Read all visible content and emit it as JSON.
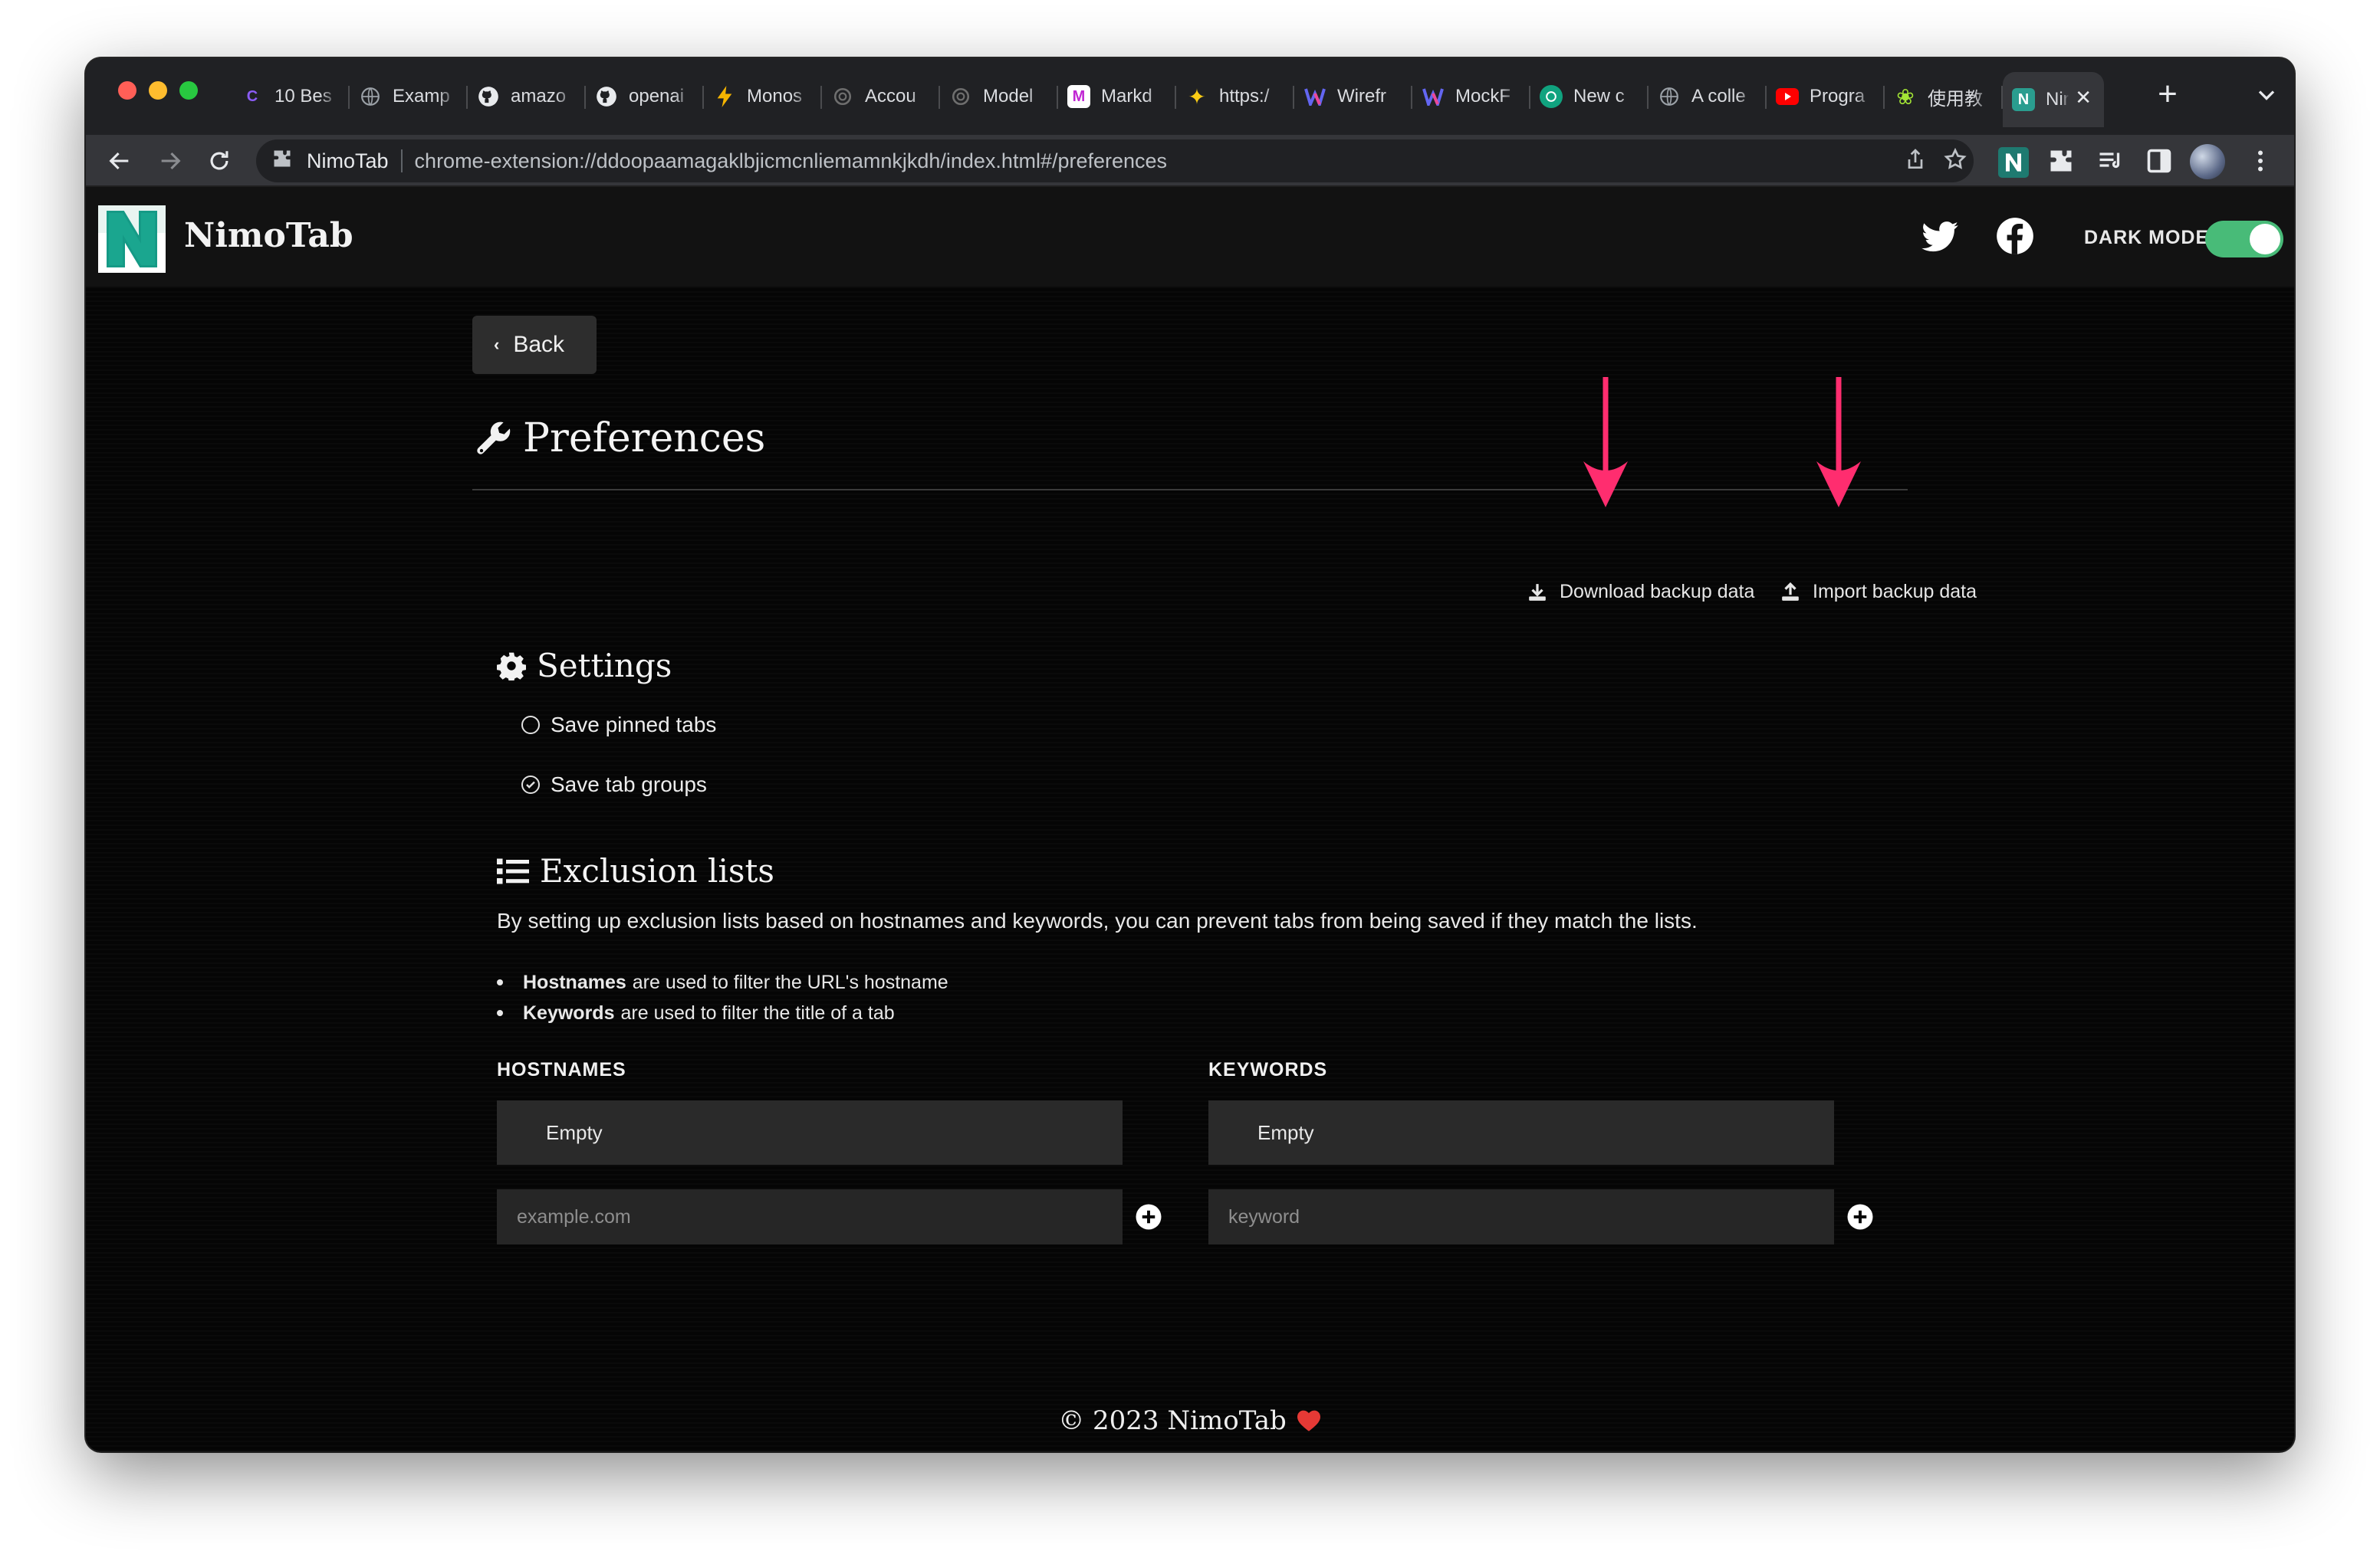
{
  "browser": {
    "tabs": [
      {
        "label": "10 Bes",
        "icon": "c-logo-icon",
        "color": "#7c3aed"
      },
      {
        "label": "Examp",
        "icon": "globe-icon",
        "color": "#9aa0a6"
      },
      {
        "label": "amazo",
        "icon": "github-icon",
        "color": "#e8eaed"
      },
      {
        "label": "openai",
        "icon": "github-icon",
        "color": "#e8eaed"
      },
      {
        "label": "Monos",
        "icon": "bolt-icon",
        "color": "#f5b400"
      },
      {
        "label": "Accou",
        "icon": "openai-icon",
        "color": "#9aa0a6"
      },
      {
        "label": "Model",
        "icon": "openai-icon",
        "color": "#9aa0a6"
      },
      {
        "label": "Markd",
        "icon": "markdown-icon",
        "color": "#c026d3"
      },
      {
        "label": "https:/",
        "icon": "sparkle-icon",
        "color": "#facc15"
      },
      {
        "label": "Wirefr",
        "icon": "wireframe-icon",
        "color": "#6366f1"
      },
      {
        "label": "MockF",
        "icon": "mockflow-icon",
        "color": "#6366f1"
      },
      {
        "label": "New c",
        "icon": "chatgpt-icon",
        "color": "#10a37f"
      },
      {
        "label": "A colle",
        "icon": "globe-icon",
        "color": "#9aa0a6"
      },
      {
        "label": "Progra",
        "icon": "youtube-icon",
        "color": "#ff0000"
      },
      {
        "label": "使用教",
        "icon": "flower-icon",
        "color": "#a3e635"
      },
      {
        "label": "Nir",
        "icon": "nimotab-icon",
        "color": "#e8eaed",
        "active": true
      }
    ],
    "omnibox": {
      "site": "NimoTab",
      "url": "chrome-extension://ddoopaamagaklbjicmcnliemamnkjkdh/index.html#/preferences"
    }
  },
  "header": {
    "brand": "NimoTab",
    "logo_letter": "N",
    "dark_mode_label": "DARK MODE",
    "dark_mode_on": true
  },
  "page": {
    "back_label": "Back",
    "title": "Preferences",
    "download_label": "Download backup data",
    "import_label": "Import backup data",
    "settings": {
      "title": "Settings",
      "options": [
        {
          "label": "Save pinned tabs",
          "checked": false
        },
        {
          "label": "Save tab groups",
          "checked": true
        }
      ]
    },
    "exclusion": {
      "title": "Exclusion lists",
      "description": "By setting up exclusion lists based on hostnames and keywords, you can prevent tabs from being saved if they match the lists.",
      "bullets": [
        {
          "strong": "Hostnames",
          "text": "are used to filter the URL's hostname"
        },
        {
          "strong": "Keywords",
          "text": "are used to filter the title of a tab"
        }
      ],
      "hostnames": {
        "title": "HOSTNAMES",
        "empty": "Empty",
        "placeholder": "example.com"
      },
      "keywords": {
        "title": "KEYWORDS",
        "empty": "Empty",
        "placeholder": "keyword"
      }
    },
    "footer": "© 2023 NimoTab"
  },
  "colors": {
    "accent_arrow": "#ff2d6f",
    "toggle_on": "#48bb78"
  }
}
